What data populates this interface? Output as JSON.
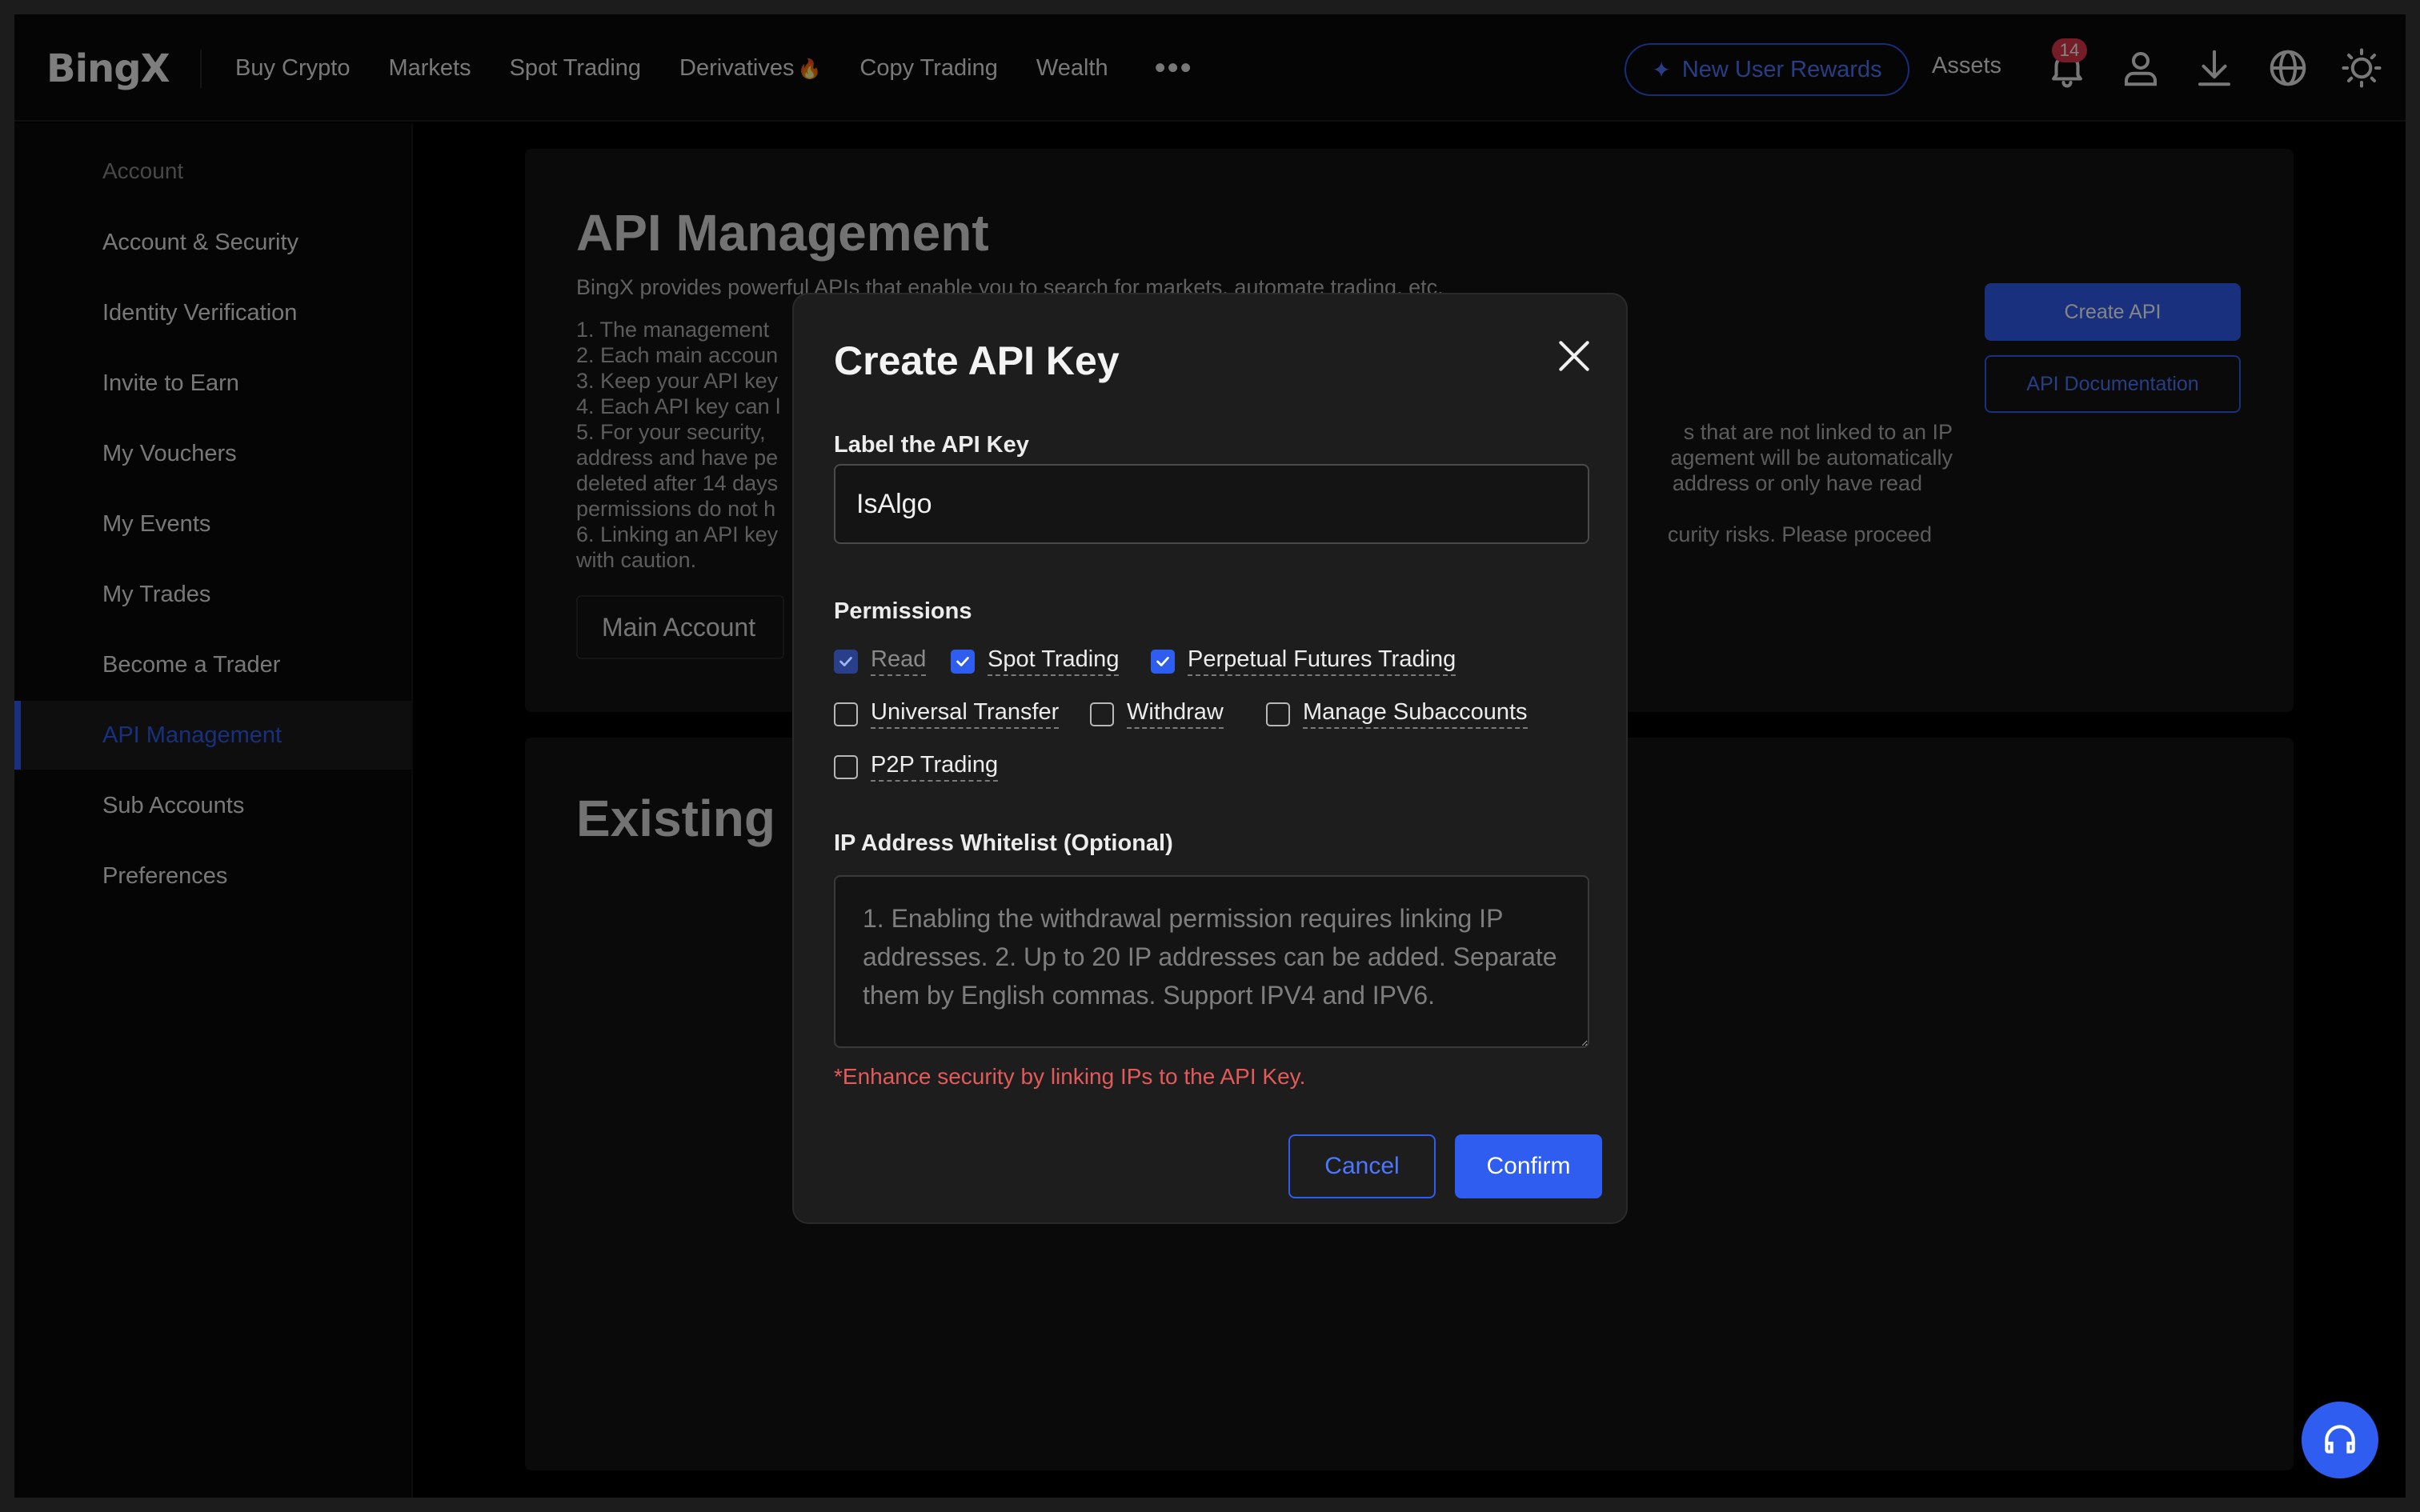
{
  "header": {
    "logo": "BingX",
    "nav": [
      {
        "label": "Buy Crypto"
      },
      {
        "label": "Markets"
      },
      {
        "label": "Spot Trading"
      },
      {
        "label": "Derivatives"
      },
      {
        "label": "Copy Trading"
      },
      {
        "label": "Wealth"
      }
    ],
    "more_icon": "more-horizontal-icon",
    "rewards_label": "New User Rewards",
    "assets_label": "Assets",
    "notification_count": "14"
  },
  "sidebar": {
    "heading": "Account",
    "items": [
      {
        "label": "Account & Security"
      },
      {
        "label": "Identity Verification"
      },
      {
        "label": "Invite to Earn"
      },
      {
        "label": "My Vouchers"
      },
      {
        "label": "My Events"
      },
      {
        "label": "My Trades"
      },
      {
        "label": "Become a Trader"
      },
      {
        "label": "API Management"
      },
      {
        "label": "Sub Accounts"
      },
      {
        "label": "Preferences"
      }
    ],
    "active": "API Management"
  },
  "main": {
    "title": "API Management",
    "description": "BingX provides powerful APIs that enable you to search for markets, automate trading, etc.",
    "notes": {
      "line1": "1. The management",
      "line2": "2. Each main accoun",
      "line3": "3. Keep your API key",
      "line4": "4. Each API key can l",
      "line5a": "5. For your security,",
      "line5a_tail": "s that are not linked to an IP",
      "line5b": "address and have pe",
      "line5b_tail": "agement will be automatically",
      "line5c": "deleted after 14 days",
      "line5c_tail": " address or only have read",
      "line5d": "permissions do not h",
      "line6": "6. Linking an API key",
      "line6_tail": "curity risks. Please proceed",
      "line6b": "with caution."
    },
    "account_select": "Main Account",
    "create_api_label": "Create API",
    "api_doc_label": "API Documentation",
    "existing_title": "Existing"
  },
  "modal": {
    "title": "Create API Key",
    "label_heading": "Label the API Key",
    "label_value": "IsAlgo",
    "permissions_heading": "Permissions",
    "permissions": [
      {
        "label": "Read",
        "checked": true,
        "disabled": true
      },
      {
        "label": "Spot Trading",
        "checked": true
      },
      {
        "label": "Perpetual Futures Trading",
        "checked": true
      },
      {
        "label": "Universal Transfer",
        "checked": false
      },
      {
        "label": "Withdraw",
        "checked": false
      },
      {
        "label": "Manage Subaccounts",
        "checked": false
      },
      {
        "label": "P2P Trading",
        "checked": false
      }
    ],
    "ip_heading": "IP Address Whitelist (Optional)",
    "ip_placeholder": "1. Enabling the withdrawal permission requires linking IP addresses. 2. Up to 20 IP addresses can be added. Separate them by English commas. Support IPV4 and IPV6.",
    "hint": "*Enhance security by linking IPs to the API Key.",
    "cancel_label": "Cancel",
    "confirm_label": "Confirm"
  },
  "colors": {
    "accent": "#2f5df0",
    "warning": "#e35a5a",
    "badge": "#e0384a"
  }
}
